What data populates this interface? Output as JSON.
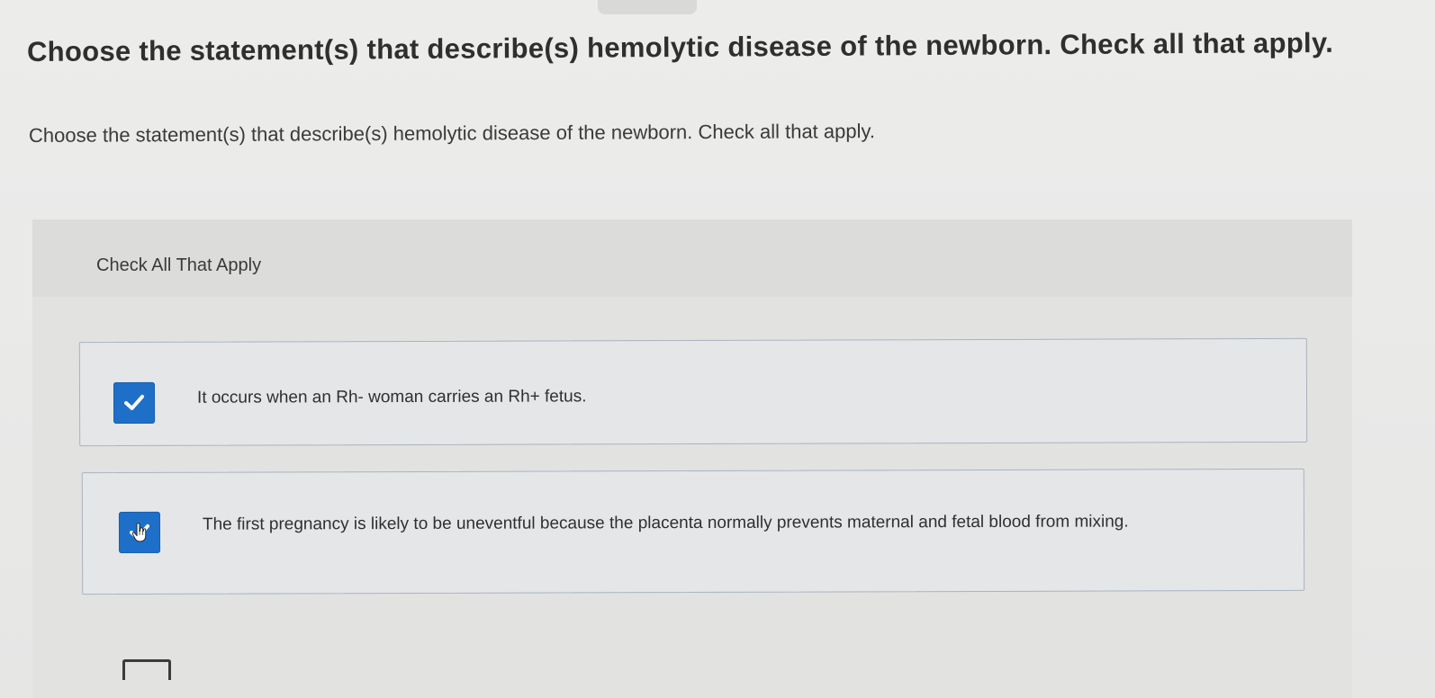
{
  "question": {
    "title": "Choose the statement(s) that describe(s) hemolytic disease of the newborn. Check all that apply.",
    "prompt": "Choose the statement(s) that describe(s) hemolytic disease of the newborn. Check all that apply."
  },
  "answers": {
    "header_label": "Check All That Apply",
    "options": [
      {
        "text": "It occurs when an Rh- woman carries an Rh+ fetus.",
        "checked": true
      },
      {
        "text": "The first pregnancy is likely to be uneventful because the placenta normally prevents maternal and fetal blood from mixing.",
        "checked": true
      }
    ]
  },
  "colors": {
    "checkbox_fill": "#1e6fc7",
    "option_border": "#a9b3bf",
    "panel_background": "#e2e2e1"
  },
  "icons": {
    "checkbox_mark": "checkmark-icon",
    "pointer": "hand-pointer-icon"
  }
}
